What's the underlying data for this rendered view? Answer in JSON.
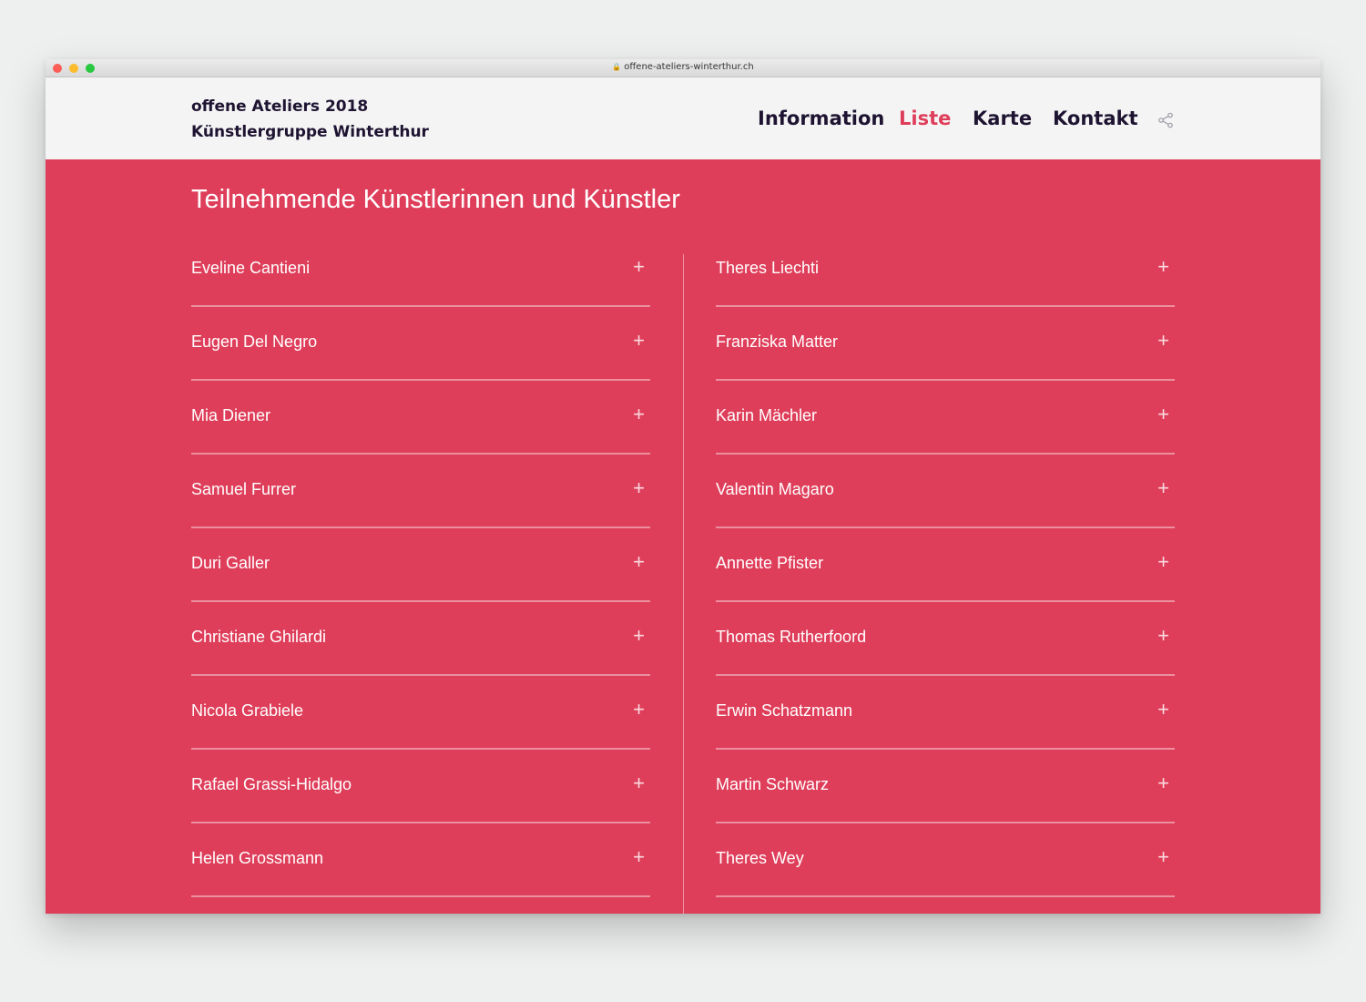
{
  "browser": {
    "url": "offene-ateliers-winterthur.ch"
  },
  "header": {
    "brand_line1": "offene Ateliers 2018",
    "brand_line2": "Künstlergruppe Winterthur",
    "nav": [
      "Information",
      "Liste",
      "Karte",
      "Kontakt"
    ],
    "active_nav": "Liste"
  },
  "main": {
    "heading": "Teilnehmende Künstlerinnen und Künstler",
    "left_column": [
      "Eveline Cantieni",
      "Eugen Del Negro",
      "Mia Diener",
      "Samuel Furrer",
      "Duri Galler",
      "Christiane Ghilardi",
      "Nicola Grabiele",
      "Rafael Grassi-Hidalgo",
      "Helen Grossmann"
    ],
    "right_column": [
      "Theres Liechti",
      "Franziska Matter",
      "Karin Mächler",
      "Valentin Magaro",
      "Annette Pfister",
      "Thomas Rutherfoord",
      "Erwin Schatzmann",
      "Martin Schwarz",
      "Theres Wey"
    ],
    "expand_symbol": "+"
  },
  "colors": {
    "accent": "#df3e5a",
    "text_dark": "#1e1432",
    "header_bg": "#f4f4f4"
  }
}
